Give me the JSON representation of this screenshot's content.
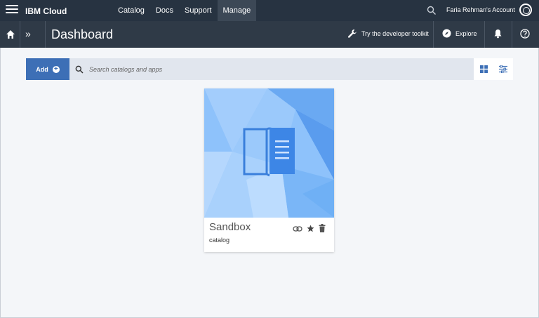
{
  "brand": "IBM Cloud",
  "nav": [
    {
      "label": "Catalog"
    },
    {
      "label": "Docs"
    },
    {
      "label": "Support"
    },
    {
      "label": "Manage"
    }
  ],
  "account": "Faria Rehman's Account",
  "page_title": "Dashboard",
  "header_actions": {
    "toolkit": "Try the developer toolkit",
    "explore": "Explore"
  },
  "toolbar": {
    "add_label": "Add",
    "search_placeholder": "Search catalogs and apps"
  },
  "card": {
    "title": "Sandbox",
    "subtitle": "catalog",
    "icon": "open-book-icon",
    "actions": [
      "link-icon",
      "star-icon",
      "trash-icon"
    ]
  },
  "colors": {
    "topbar": "#273341",
    "subbar": "#2f3a47",
    "accent": "#3d6fb6",
    "card_art": "#7db4f5"
  }
}
